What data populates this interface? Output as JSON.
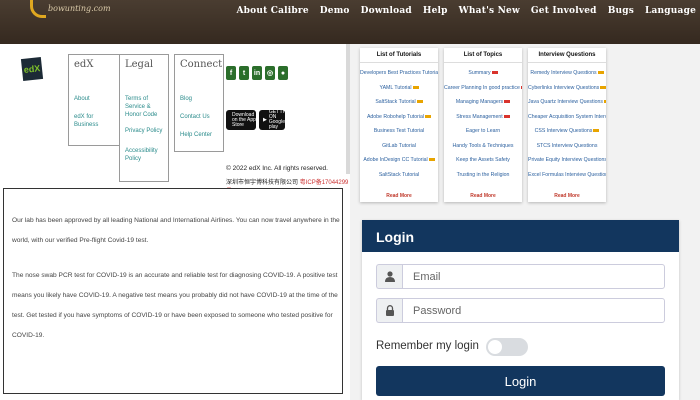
{
  "header": {
    "logo_text": "bowunting.com",
    "nav": [
      "About Calibre",
      "Demo",
      "Download",
      "Help",
      "What's New",
      "Get Involved",
      "Bugs",
      "Language"
    ]
  },
  "footer": {
    "logo": "edX",
    "columns": [
      {
        "title": "edX",
        "links": [
          "About",
          "edX for Business"
        ]
      },
      {
        "title": "Legal",
        "links": [
          "Terms of Service & Honor Code",
          "Privacy Policy",
          "Accessibility Policy"
        ]
      },
      {
        "title": "Connect",
        "links": [
          "Blog",
          "Contact Us",
          "Help Center"
        ]
      }
    ],
    "social_icons": [
      "facebook-icon",
      "twitter-icon",
      "linkedin-icon",
      "instagram-icon",
      "reddit-icon"
    ],
    "app_store": "Download on the App Store",
    "google_play": "GET IT ON Google play",
    "copyright": "© 2022 edX Inc. All rights reserved.",
    "icp_text": "深圳市恒宇博科技有限公司",
    "icp_link": "粤ICP备17044299号"
  },
  "content": {
    "para1": "Our lab has been approved by all leading National and International Airlines. You can now travel anywhere in the world, with our verified Pre-flight Covid-19 test.",
    "para2": "The nose swab PCR test for COVID-19 is an accurate and reliable test for diagnosing COVID-19. A positive test means you likely have COVID-19. A negative test means you probably did not have COVID-19 at the time of the test. Get tested if you have symptoms of COVID-19 or have been exposed to someone who tested positive for COVID-19."
  },
  "cards": [
    {
      "title": "List of Tutorials",
      "items": [
        "Developers Best Practices Tutorial",
        "YAML Tutorial",
        "SaltStack Tutorial",
        "Adobe Robohelp Tutorial",
        "Business Test Tutorial",
        "GitLab Tutorial",
        "Adobe InDesign CC Tutorial",
        "SaltStack Tutorial"
      ],
      "badges": [
        "y",
        "y",
        "y",
        "y",
        "",
        "",
        "y",
        ""
      ],
      "read_more": "Read More"
    },
    {
      "title": "List of Topics",
      "items": [
        "Summary",
        "Career Planning In good practice",
        "Managing Managers",
        "Stress Management",
        "Eager to Learn",
        "Handy Tools & Techniques",
        "Keep the Assets Safety",
        "Trusting in the Religion"
      ],
      "badges": [
        "r",
        "r",
        "r",
        "r",
        "",
        "",
        "",
        ""
      ],
      "read_more": "Read More"
    },
    {
      "title": "Interview Questions",
      "items": [
        "Remedy Interview Questions",
        "Cyberlinks Interview Questions",
        "Java Quartz Interview Questions",
        "Cheaper Acquisition System Interview Questions",
        "CSS Interview Questions",
        "STCS Interview Questions",
        "Private Equity Interview Questions",
        "Excel Formulas Interview Questions"
      ],
      "badges": [
        "y",
        "y",
        "y",
        "y",
        "y",
        "",
        "",
        ""
      ],
      "read_more": "Read More"
    }
  ],
  "login": {
    "title": "Login",
    "email_placeholder": "Email",
    "password_placeholder": "Password",
    "remember_label": "Remember my login",
    "button_label": "Login"
  }
}
